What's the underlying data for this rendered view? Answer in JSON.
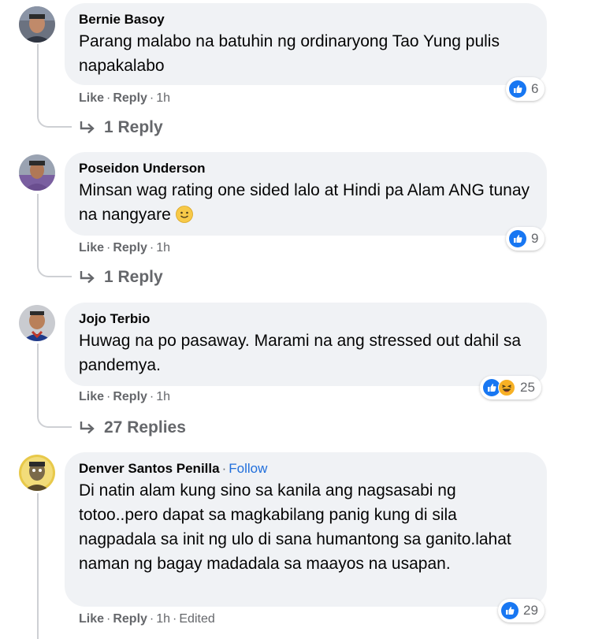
{
  "actions": {
    "like": "Like",
    "reply": "Reply",
    "separator": "·"
  },
  "comments": [
    {
      "author": "Bernie Basoy",
      "text": "Parang malabo na batuhin ng ordinaryong Tao Yung pulis napakalabo",
      "time": "1h",
      "reaction_count": "6",
      "reactions": [
        "like"
      ],
      "replies_label": "1 Reply"
    },
    {
      "author": "Poseidon Underson",
      "text": "Minsan wag rating one sided lalo at Hindi pa Alam ANG tunay na nangyare",
      "emoji": "slightly-smiling-face",
      "time": "1h",
      "reaction_count": "9",
      "reactions": [
        "like"
      ],
      "replies_label": "1 Reply"
    },
    {
      "author": "Jojo Terbio",
      "text": "Huwag na po pasaway. Marami na ang stressed out dahil sa pandemya.",
      "time": "1h",
      "reaction_count": "25",
      "reactions": [
        "like",
        "haha"
      ],
      "replies_label": "27 Replies"
    },
    {
      "author": "Denver Santos Penilla",
      "follow_label": "Follow",
      "text": "Di natin alam kung sino sa kanila ang nagsasabi ng totoo..pero dapat sa magkabilang panig kung di sila nagpadala sa init ng ulo di sana humantong sa ganito.lahat naman ng bagay madadala sa maayos na usapan.",
      "time": "1h",
      "edited_label": "Edited",
      "reaction_count": "29",
      "reactions": [
        "like"
      ]
    }
  ],
  "colors": {
    "like_blue": "#1877f2",
    "haha_yellow": "#f7b125",
    "link_blue": "#216fdb",
    "muted": "#65676b",
    "bubble": "#f0f2f5"
  }
}
